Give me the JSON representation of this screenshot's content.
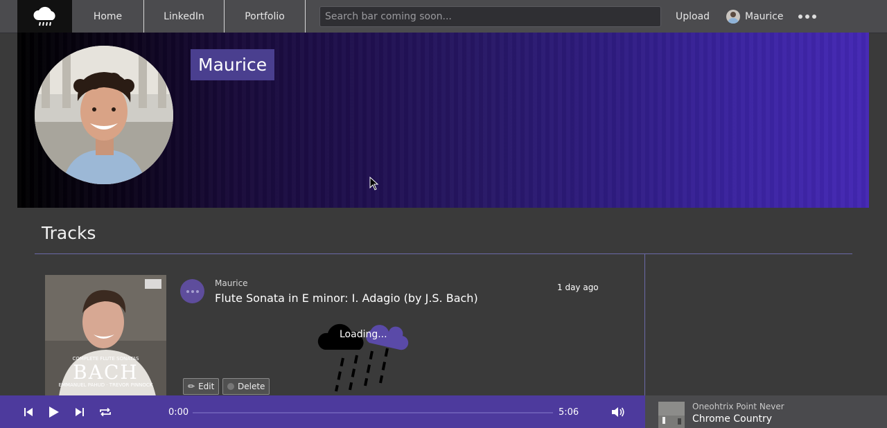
{
  "nav": {
    "links": [
      "Home",
      "LinkedIn",
      "Portfolio"
    ],
    "search_placeholder": "Search bar coming soon...",
    "upload": "Upload",
    "user": "Maurice"
  },
  "banner": {
    "name": "Maurice"
  },
  "tracks": {
    "heading": "Tracks",
    "items": [
      {
        "artist": "Maurice",
        "title": "Flute Sonata in E minor: I. Adagio (by J.S. Bach)",
        "time_ago": "1 day ago",
        "loading": "Loading...",
        "edit": "Edit",
        "delete": "Delete",
        "cover": {
          "subtitle": "COMPLETE FLUTE SONATAS",
          "title": "BACH",
          "performers": "EMMANUEL PAHUD · TREVOR PINNOCK"
        }
      }
    ]
  },
  "player": {
    "current_time": "0:00",
    "duration": "5:06",
    "progress": 0,
    "now_playing": {
      "artist": "Oneohtrix Point Never",
      "title": "Chrome Country"
    }
  },
  "colors": {
    "nav_bg": "#4b4b4e",
    "accent": "#4d3a9d",
    "banner_name_bg": "#4a3f8f",
    "page_bg": "#3a3a3a"
  }
}
